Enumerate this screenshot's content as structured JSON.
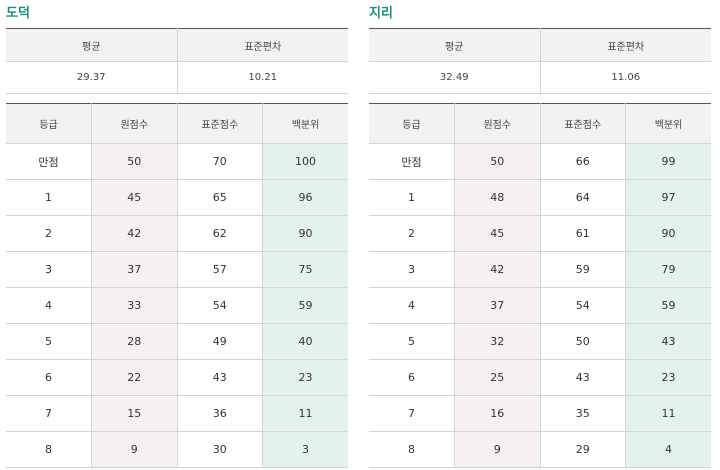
{
  "tables": [
    {
      "title": "도덕",
      "summary": {
        "mean_label": "평균",
        "sd_label": "표준편차",
        "mean": "29.37",
        "sd": "10.21"
      },
      "headers": [
        "등급",
        "원점수",
        "표준점수",
        "백분위"
      ],
      "rows": [
        [
          "만점",
          "50",
          "70",
          "100"
        ],
        [
          "1",
          "45",
          "65",
          "96"
        ],
        [
          "2",
          "42",
          "62",
          "90"
        ],
        [
          "3",
          "37",
          "57",
          "75"
        ],
        [
          "4",
          "33",
          "54",
          "59"
        ],
        [
          "5",
          "28",
          "49",
          "40"
        ],
        [
          "6",
          "22",
          "43",
          "23"
        ],
        [
          "7",
          "15",
          "36",
          "11"
        ],
        [
          "8",
          "9",
          "30",
          "3"
        ]
      ]
    },
    {
      "title": "지리",
      "summary": {
        "mean_label": "평균",
        "sd_label": "표준편차",
        "mean": "32.49",
        "sd": "11.06"
      },
      "headers": [
        "등급",
        "원점수",
        "표준점수",
        "백분위"
      ],
      "rows": [
        [
          "만점",
          "50",
          "66",
          "99"
        ],
        [
          "1",
          "48",
          "64",
          "97"
        ],
        [
          "2",
          "45",
          "61",
          "90"
        ],
        [
          "3",
          "42",
          "59",
          "79"
        ],
        [
          "4",
          "37",
          "54",
          "59"
        ],
        [
          "5",
          "32",
          "50",
          "43"
        ],
        [
          "6",
          "25",
          "43",
          "23"
        ],
        [
          "7",
          "16",
          "35",
          "11"
        ],
        [
          "8",
          "9",
          "29",
          "4"
        ]
      ]
    }
  ]
}
